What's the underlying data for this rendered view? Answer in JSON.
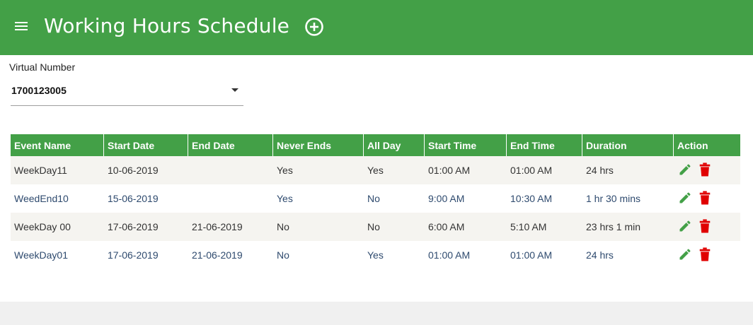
{
  "header": {
    "title": "Working Hours Schedule",
    "menu_icon": "menu-icon",
    "add_icon": "add-circle-icon",
    "color": "#43a047"
  },
  "filter": {
    "label": "Virtual Number",
    "selected_value": "1700123005"
  },
  "table": {
    "columns": [
      "Event Name",
      "Start Date",
      "End Date",
      "Never Ends",
      "All Day",
      "Start Time",
      "End Time",
      "Duration",
      "Action"
    ],
    "rows": [
      {
        "event_name": "WeekDay11",
        "start_date": "10-06-2019",
        "end_date": "",
        "never_ends": "Yes",
        "all_day": "Yes",
        "start_time": "01:00 AM",
        "end_time": "01:00 AM",
        "duration": "24 hrs"
      },
      {
        "event_name": "WeedEnd10",
        "start_date": "15-06-2019",
        "end_date": "",
        "never_ends": "Yes",
        "all_day": "No",
        "start_time": "9:00 AM",
        "end_time": "10:30 AM",
        "duration": "1 hr 30 mins"
      },
      {
        "event_name": "WeekDay 00",
        "start_date": "17-06-2019",
        "end_date": "21-06-2019",
        "never_ends": "No",
        "all_day": "No",
        "start_time": "6:00 AM",
        "end_time": "5:10 AM",
        "duration": "23 hrs 1 min"
      },
      {
        "event_name": "WeekDay01",
        "start_date": "17-06-2019",
        "end_date": "21-06-2019",
        "never_ends": "No",
        "all_day": "Yes",
        "start_time": "01:00 AM",
        "end_time": "01:00 AM",
        "duration": "24 hrs"
      }
    ],
    "action_icons": [
      "edit-icon",
      "delete-icon"
    ],
    "edit_color": "#43a047",
    "delete_color": "#e00000"
  }
}
